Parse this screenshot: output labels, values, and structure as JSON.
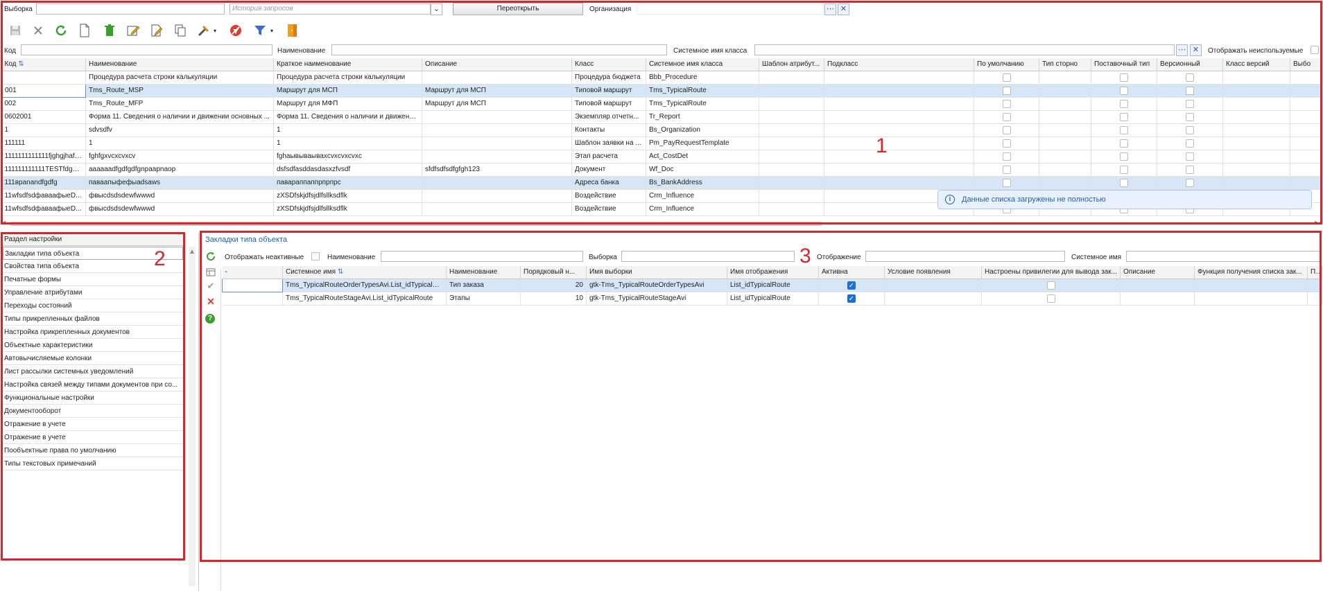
{
  "filter_bar": {
    "selection_label": "Выборка",
    "history_placeholder": "История запросов",
    "reopen_button": "Переоткрыть",
    "organization_label": "Организация"
  },
  "search_bar": {
    "code_label": "Код",
    "name_label": "Наименование",
    "system_class_label": "Системное имя класса",
    "show_unused_label": "Отображать неиспользуемые"
  },
  "main_table": {
    "columns": [
      "Код",
      "Наименование",
      "Краткое наименование",
      "Описание",
      "Класс",
      "Системное имя класса",
      "Шаблон атрибут...",
      "Подкласс",
      "По умолчанию",
      "Тип сторно",
      "Поставочный тип",
      "Версионный",
      "Класс версий",
      "Выбо"
    ],
    "rows": [
      {
        "code": "",
        "name": "Процедура расчета строки калькуляции",
        "short": "Процедура расчета строки калькуляции",
        "desc": "",
        "cls": "Процедура бюджета",
        "sys": "Bbb_Procedure"
      },
      {
        "code": "001",
        "name": "Tms_Route_MSP",
        "short": "Маршрут для МСП",
        "desc": "Маршрут для МСП",
        "cls": "Типовой маршрут",
        "sys": "Tms_TypicalRoute"
      },
      {
        "code": "002",
        "name": "Tms_Route_MFP",
        "short": "Маршрут для МФП",
        "desc": "Маршрут для МСП",
        "cls": "Типовой маршрут",
        "sys": "Tms_TypicalRoute"
      },
      {
        "code": "0602001",
        "name": "Форма 11. Сведения о наличии и движении основных ...",
        "short": "Форма 11. Сведения о наличии и движени...",
        "desc": "",
        "cls": "Экземпляр отчетн...",
        "sys": "Tr_Report"
      },
      {
        "code": "1",
        "name": "sdvsdfv",
        "short": "1",
        "desc": "",
        "cls": "Контакты",
        "sys": "Bs_Organization"
      },
      {
        "code": "111111",
        "name": "1",
        "short": "1",
        "desc": "",
        "cls": "Шаблон заявки на ...",
        "sys": "Pm_PayRequestTemplate"
      },
      {
        "code": "1111111111111fjghgjhafds...",
        "name": "fghfgxvcxcvxcv",
        "short": "fghаывываываxcvxcvxcvxc",
        "desc": "",
        "cls": "Этап расчета",
        "sys": "Act_CostDet"
      },
      {
        "code": "111111111111TESTfdghdf...",
        "name": "aaaaaadfgdfgdfgnpaapnaop",
        "short": "dsfsdfasddasdasxzfvsdf",
        "desc": "sfdfsdfsdfgfgh123",
        "cls": "Документ",
        "sys": "Wf_Doc"
      },
      {
        "code": "111вpanandfgdfg",
        "name": "паваапыфефыadsaws",
        "short": "павараппаппрпрпрс",
        "desc": "",
        "cls": "Адреса банка",
        "sys": "Bs_BankAddress"
      },
      {
        "code": "11wfsdfsdфаваафыеD...",
        "name": "фвысdsdsdewfwwwd",
        "short": "zXSDfskjdfsjdlfsllksdflk",
        "desc": "",
        "cls": "Воздействие",
        "sys": "Crm_Influence"
      },
      {
        "code": "11wfsdfsdфаваафыеD...",
        "name": "фвысdsdsdewfwwwd",
        "short": "zXSDfskjdfsjdlfsllksdflk",
        "desc": "",
        "cls": "Воздействие",
        "sys": "Crm_Influence"
      }
    ]
  },
  "toast": {
    "text": "Данные списка загружены не полностью"
  },
  "sidebar": {
    "header": "Раздел настройки",
    "items": [
      "Закладки типа объекта",
      "Свойства типа объекта",
      "Печатные формы",
      "Управление атрибутами",
      "Переходы состояний",
      "Типы прикрепленных файлов",
      "Настройка прикрепленных документов",
      "Объектные характеристики",
      "Автовычисляемые колонки",
      "Лист рассылки системных уведомлений",
      "Настройка связей между типами документов при со...",
      "Функциональные настройки",
      "Документооборот",
      "Отражение в учете",
      "Отражение в учете",
      "Пообъектные права по умолчанию",
      "Типы текстовых примечаний"
    ]
  },
  "detail": {
    "title": "Закладки типа объекта",
    "filters": {
      "show_inactive": "Отображать неактивные",
      "name": "Наименование",
      "selection": "Выборка",
      "display": "Отображение",
      "system_name": "Системное имя"
    },
    "columns": [
      "-",
      "Системное имя",
      "Наименование",
      "Порядковый н...",
      "Имя выборки",
      "Имя отображения",
      "Активна",
      "Условие появления",
      "Настроены привилегии для вывода зак...",
      "Описание",
      "Функция получения списка зак...",
      "Па"
    ],
    "rows": [
      {
        "sys": "Tms_TypicalRouteOrderTypesAvi.List_idTypicalR...",
        "name": "Тип заказа",
        "order": "20",
        "sel": "gtk-Tms_TypicalRouteOrderTypesAvi",
        "disp": "List_idTypicalRoute"
      },
      {
        "sys": "Tms_TypicalRouteStageAvi.List_idTypicalRoute",
        "name": "Этапы",
        "order": "10",
        "sel": "gtk-Tms_TypicalRouteStageAvi",
        "disp": "List_idTypicalRoute"
      }
    ]
  },
  "annotations": [
    "1",
    "2",
    "3"
  ],
  "colors": {
    "annotation": "#d9242b",
    "accent": "#1f5db3",
    "selection": "#d6e6f7"
  }
}
